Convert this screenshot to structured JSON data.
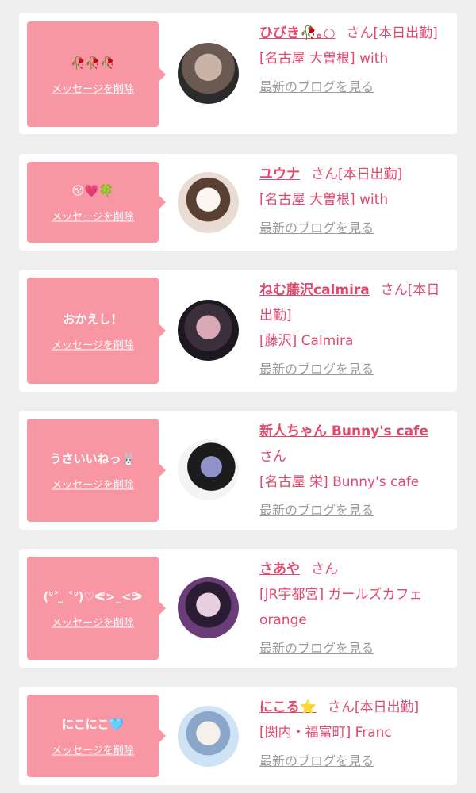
{
  "cards": [
    {
      "message": "🥀🥀🥀",
      "delete_label": "メッセージを削除",
      "name": "ひびき🥀｡○",
      "suffix": "さん[本日出勤]",
      "shop": "[名古屋 大曽根] with",
      "blog_label": "最新のブログを見る",
      "avatar_colors": [
        "#6b5a52",
        "#c9b2a6",
        "#2b2b2b"
      ]
    },
    {
      "message": "😚💗🍀",
      "delete_label": "メッセージを削除",
      "name": "ユウナ",
      "suffix": "さん[本日出勤]",
      "shop": "[名古屋 大曽根] with",
      "blog_label": "最新のブログを見る",
      "avatar_colors": [
        "#e9dcd4",
        "#5a3f33",
        "#fbf5f0"
      ]
    },
    {
      "message": "おかえし！",
      "delete_label": "メッセージを削除",
      "name": "ねむ藤沢calmira",
      "suffix": "さん[本日出勤]",
      "shop": "[藤沢] Calmira",
      "blog_label": "最新のブログを見る",
      "avatar_colors": [
        "#3a2f3a",
        "#d9a9b8",
        "#1d1820"
      ]
    },
    {
      "message": "うさいいねっ🐰",
      "delete_label": "メッセージを削除",
      "name": "新人ちゃん Bunny's cafe",
      "suffix": "さん",
      "shop": "[名古屋 栄] Bunny's cafe",
      "blog_label": "最新のブログを見る",
      "avatar_colors": [
        "#f4f4f4",
        "#1c1c1c",
        "#8f93c9"
      ]
    },
    {
      "message": "(ᐡ˃ ̫ ˂ᐡ)♡ᕙ>_<ᕗ",
      "delete_label": "メッセージを削除",
      "name": "さあや",
      "suffix": "さん",
      "shop": "[JR宇都宮] ガールズカフェ orange",
      "blog_label": "最新のブログを見る",
      "avatar_colors": [
        "#6a3d78",
        "#e8cfe0",
        "#2a1c33"
      ]
    },
    {
      "message": "にこにこ🩵",
      "delete_label": "メッセージを削除",
      "name": "にこる⭐",
      "suffix": "さん[本日出勤]",
      "shop": "[関内・福富町] Franc",
      "blog_label": "最新のブログを見る",
      "avatar_colors": [
        "#cfe3f5",
        "#f6f0ea",
        "#8aa7c9"
      ]
    }
  ]
}
